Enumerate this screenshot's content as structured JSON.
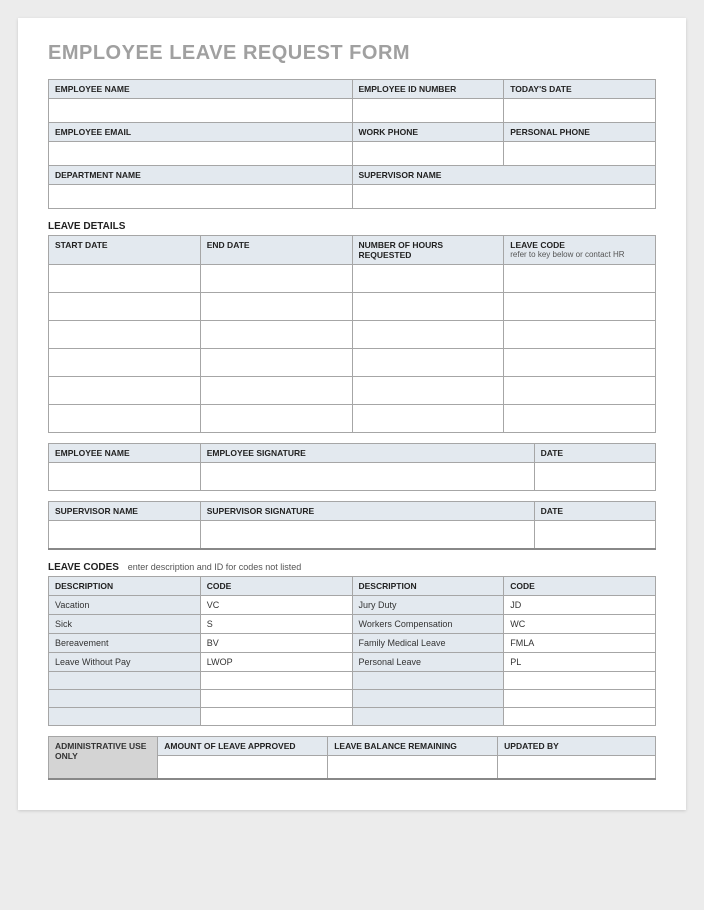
{
  "title": "EMPLOYEE LEAVE REQUEST FORM",
  "info": {
    "employee_name": "EMPLOYEE NAME",
    "employee_id": "EMPLOYEE ID NUMBER",
    "todays_date": "TODAY'S DATE",
    "employee_email": "EMPLOYEE EMAIL",
    "work_phone": "WORK PHONE",
    "personal_phone": "PERSONAL PHONE",
    "department_name": "DEPARTMENT NAME",
    "supervisor_name": "SUPERVISOR NAME"
  },
  "leave_details": {
    "section": "LEAVE DETAILS",
    "start_date": "START DATE",
    "end_date": "END DATE",
    "hours": "NUMBER OF HOURS REQUESTED",
    "code": "LEAVE CODE",
    "code_sub": "refer to key below or contact HR"
  },
  "emp_sig": {
    "name": "EMPLOYEE NAME",
    "signature": "EMPLOYEE SIGNATURE",
    "date": "DATE"
  },
  "sup_sig": {
    "name": "SUPERVISOR NAME",
    "signature": "SUPERVISOR SIGNATURE",
    "date": "DATE"
  },
  "leave_codes": {
    "section": "LEAVE CODES",
    "hint": "enter description and ID for codes not listed",
    "description": "DESCRIPTION",
    "code": "CODE",
    "rows": [
      {
        "d1": "Vacation",
        "c1": "VC",
        "d2": "Jury Duty",
        "c2": "JD"
      },
      {
        "d1": "Sick",
        "c1": "S",
        "d2": "Workers Compensation",
        "c2": "WC"
      },
      {
        "d1": "Bereavement",
        "c1": "BV",
        "d2": "Family Medical Leave",
        "c2": "FMLA"
      },
      {
        "d1": "Leave Without Pay",
        "c1": "LWOP",
        "d2": "Personal Leave",
        "c2": "PL"
      }
    ]
  },
  "admin": {
    "label": "ADMINISTRATIVE USE ONLY",
    "approved": "AMOUNT OF LEAVE APPROVED",
    "remaining": "LEAVE BALANCE REMAINING",
    "updated_by": "UPDATED BY"
  }
}
